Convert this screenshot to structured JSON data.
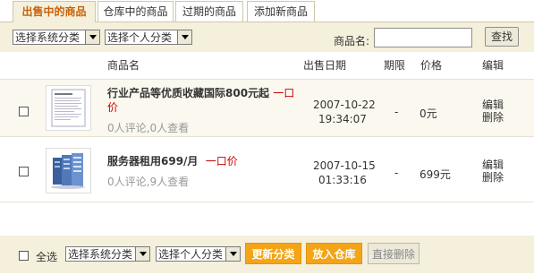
{
  "tabs": [
    {
      "label": "出售中的商品",
      "active": true
    },
    {
      "label": "仓库中的商品",
      "active": false
    },
    {
      "label": "过期的商品",
      "active": false
    },
    {
      "label": "添加新商品",
      "active": false
    }
  ],
  "filters": {
    "system_category": "选择系统分类",
    "personal_category": "选择个人分类",
    "product_name_label": "商品名:",
    "search_value": "",
    "search_button": "查找"
  },
  "table": {
    "headers": {
      "name": "商品名",
      "date": "出售日期",
      "term": "期限",
      "price": "价格",
      "edit": "编辑"
    },
    "rows": [
      {
        "title": "行业产品等优质收藏国际800元起",
        "price_tag": "一口价",
        "stats": "0人评论,0人查看",
        "date": "2007-10-22",
        "time": "19:34:07",
        "term": "-",
        "price": "0元",
        "edit": "编辑",
        "delete": "删除"
      },
      {
        "title": "服务器租用699/月",
        "price_tag": "一口价",
        "stats": "0人评论,9人查看",
        "date": "2007-10-15",
        "time": "01:33:16",
        "term": "-",
        "price": "699元",
        "edit": "编辑",
        "delete": "删除"
      }
    ]
  },
  "bottom": {
    "select_all": "全选",
    "system_category": "选择系统分类",
    "personal_category": "选择个人分类",
    "update_button": "更新分类",
    "warehouse_button": "放入仓库",
    "delete_button": "直接删除"
  },
  "colors": {
    "accent": "#f4a417",
    "bar_bg": "#f4f0dc",
    "active_tab_text": "#c8620b",
    "price_tag": "#cc0000"
  }
}
